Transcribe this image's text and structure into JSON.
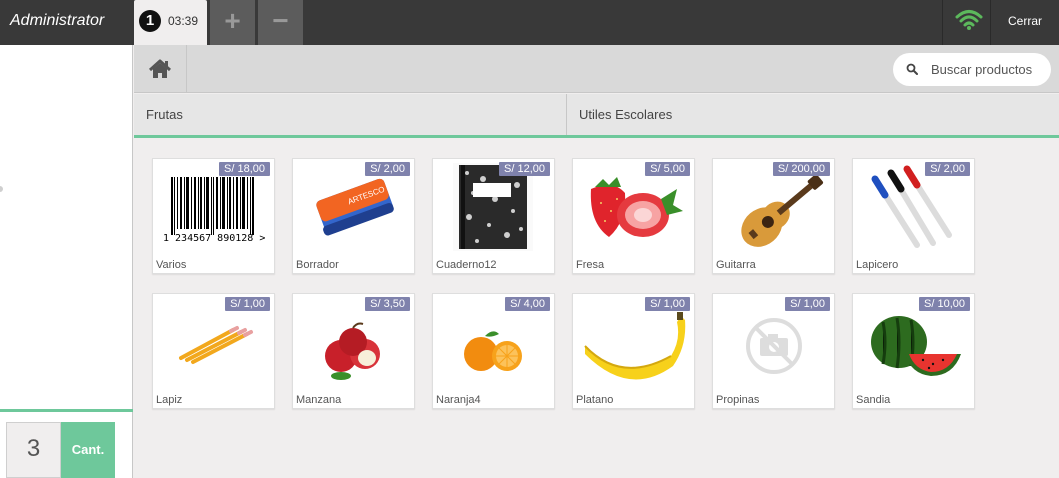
{
  "header": {
    "user": "Administrator",
    "order": {
      "number": "1",
      "time": "03:39"
    },
    "add_label": "+",
    "remove_label": "−",
    "close_label": "Cerrar"
  },
  "numpad": {
    "key_3": "3",
    "qty_label": "Cant."
  },
  "search": {
    "placeholder": "Buscar productos"
  },
  "categories": [
    "Frutas",
    "Utiles Escolares"
  ],
  "products": [
    {
      "name": "Varios",
      "price": "S/ 18,00",
      "icon": "barcode"
    },
    {
      "name": "Borrador",
      "price": "S/ 2,00",
      "icon": "eraser"
    },
    {
      "name": "Cuaderno12",
      "price": "S/ 12,00",
      "icon": "notebook"
    },
    {
      "name": "Fresa",
      "price": "S/ 5,00",
      "icon": "strawberry"
    },
    {
      "name": "Guitarra",
      "price": "S/ 200,00",
      "icon": "guitar"
    },
    {
      "name": "Lapicero",
      "price": "S/ 2,00",
      "icon": "pens"
    },
    {
      "name": "Lapiz",
      "price": "S/ 1,00",
      "icon": "pencils"
    },
    {
      "name": "Manzana",
      "price": "S/ 3,50",
      "icon": "apples"
    },
    {
      "name": "Naranja4",
      "price": "S/ 4,00",
      "icon": "oranges"
    },
    {
      "name": "Platano",
      "price": "S/ 1,00",
      "icon": "banana"
    },
    {
      "name": "Propinas",
      "price": "S/ 1,00",
      "icon": "no-photo"
    },
    {
      "name": "Sandia",
      "price": "S/ 10,00",
      "icon": "watermelon"
    }
  ],
  "barcode_text": "1 234567 890128 >",
  "eraser_brand": "ARTESCO",
  "colors": {
    "accent": "#6ec89b",
    "price_badge": "#7f82ac",
    "topbar": "#393939"
  }
}
